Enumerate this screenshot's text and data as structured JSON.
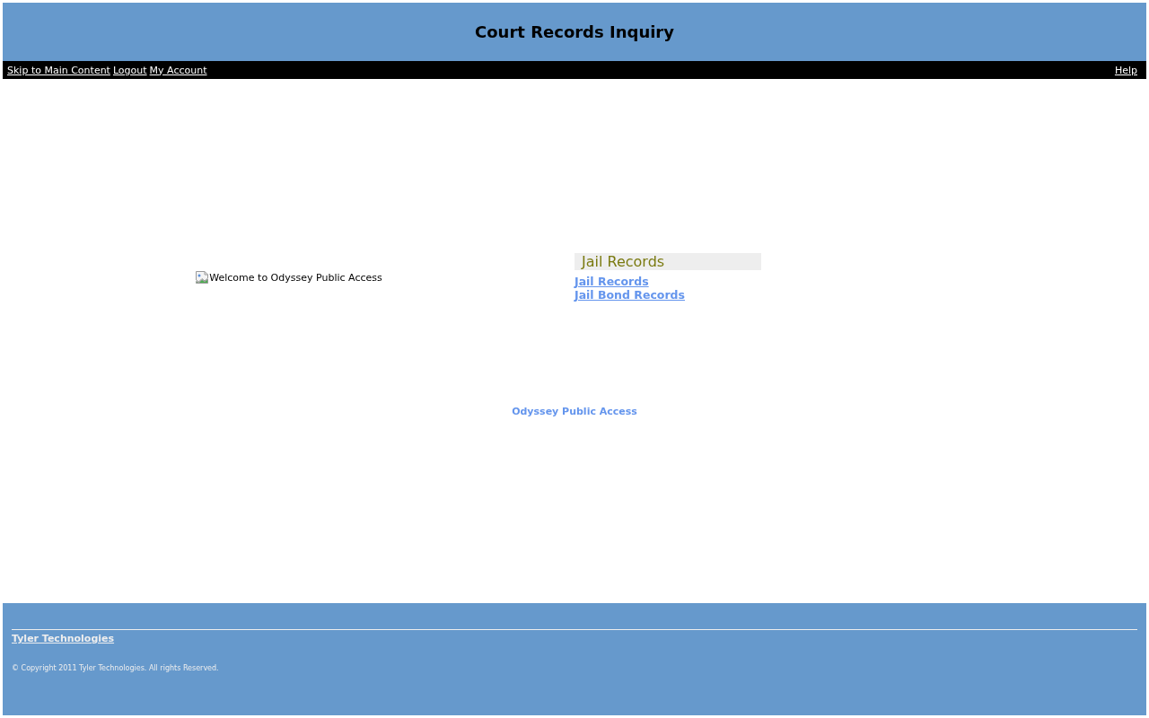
{
  "header": {
    "title": "Court Records Inquiry"
  },
  "nav": {
    "left_links": [
      "Skip to Main Content",
      "Logout",
      "My Account"
    ],
    "right_links": [
      "Help"
    ]
  },
  "welcome_image": {
    "alt_text": "Welcome to Odyssey Public Access"
  },
  "jail_panel": {
    "title": "Jail Records",
    "links": [
      "Jail Records",
      "Jail Bond Records"
    ]
  },
  "caption": "Odyssey Public Access",
  "footer": {
    "link": "Tyler Technologies",
    "copyright": "© Copyright 2011 Tyler Technologies. All rights Reserved."
  }
}
